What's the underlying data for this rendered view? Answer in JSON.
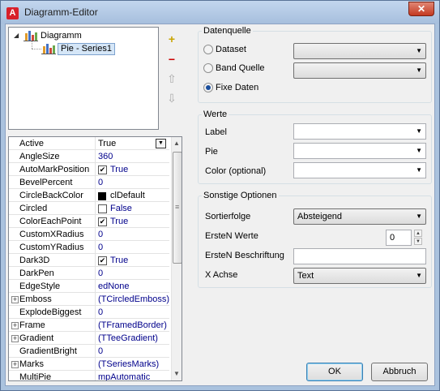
{
  "window": {
    "title": "Diagramm-Editor",
    "app_icon_letter": "A",
    "close_glyph": "✕"
  },
  "tree": {
    "items": [
      {
        "label": "Diagramm",
        "expander": "◢"
      },
      {
        "label": "Pie - Series1"
      }
    ]
  },
  "toolbar": {
    "add_glyph": "+",
    "remove_glyph": "−",
    "up_glyph": "⇧",
    "down_glyph": "⇩"
  },
  "property_grid": {
    "rows": [
      {
        "name": "Active",
        "value": "True",
        "dropdown": true
      },
      {
        "name": "AngleSize",
        "value": "360",
        "blue": true
      },
      {
        "name": "AutoMarkPosition",
        "value": "True",
        "checkbox": true,
        "checked": true
      },
      {
        "name": "BevelPercent",
        "value": "0",
        "blue": true
      },
      {
        "name": "CircleBackColor",
        "value": "clDefault",
        "swatch": "#000000"
      },
      {
        "name": "Circled",
        "value": "False",
        "checkbox": true,
        "checked": false
      },
      {
        "name": "ColorEachPoint",
        "value": "True",
        "checkbox": true,
        "checked": true
      },
      {
        "name": "CustomXRadius",
        "value": "0",
        "blue": true
      },
      {
        "name": "CustomYRadius",
        "value": "0",
        "blue": true
      },
      {
        "name": "Dark3D",
        "value": "True",
        "checkbox": true,
        "checked": true
      },
      {
        "name": "DarkPen",
        "value": "0",
        "blue": true
      },
      {
        "name": "EdgeStyle",
        "value": "edNone",
        "blue": true
      },
      {
        "name": "Emboss",
        "value": "(TCircledEmboss)",
        "blue": true,
        "expandable": true
      },
      {
        "name": "ExplodeBiggest",
        "value": "0",
        "blue": true
      },
      {
        "name": "Frame",
        "value": "(TFramedBorder)",
        "blue": true,
        "expandable": true
      },
      {
        "name": "Gradient",
        "value": "(TTeeGradient)",
        "blue": true,
        "expandable": true
      },
      {
        "name": "GradientBright",
        "value": "0",
        "blue": true
      },
      {
        "name": "Marks",
        "value": "(TSeriesMarks)",
        "blue": true,
        "expandable": true
      },
      {
        "name": "MultiPie",
        "value": "mpAutomatic",
        "blue": true
      }
    ],
    "check_glyph": "✔",
    "plus_glyph": "+",
    "dropdown_glyph": "▼",
    "scroll_up": "▲",
    "scroll_down": "▼",
    "scroll_grip": "≡"
  },
  "datenquelle": {
    "legend": "Datenquelle",
    "options": [
      {
        "label": "Dataset",
        "selected": false
      },
      {
        "label": "Band Quelle",
        "selected": false
      },
      {
        "label": "Fixe Daten",
        "selected": true
      }
    ]
  },
  "werte": {
    "legend": "Werte",
    "fields": [
      {
        "label": "Label"
      },
      {
        "label": "Pie"
      },
      {
        "label": "Color (optional)"
      }
    ]
  },
  "sonstige": {
    "legend": "Sonstige Optionen",
    "sortierfolge_label": "Sortierfolge",
    "sortierfolge_value": "Absteigend",
    "erste_n_werte_label": "ErsteN Werte",
    "erste_n_werte_value": "0",
    "erste_n_beschriftung_label": "ErsteN Beschriftung",
    "x_achse_label": "X Achse",
    "x_achse_value": "Text"
  },
  "combo_arrow": "▼",
  "spin_up": "▲",
  "spin_down": "▼",
  "buttons": {
    "ok": "OK",
    "cancel": "Abbruch"
  }
}
